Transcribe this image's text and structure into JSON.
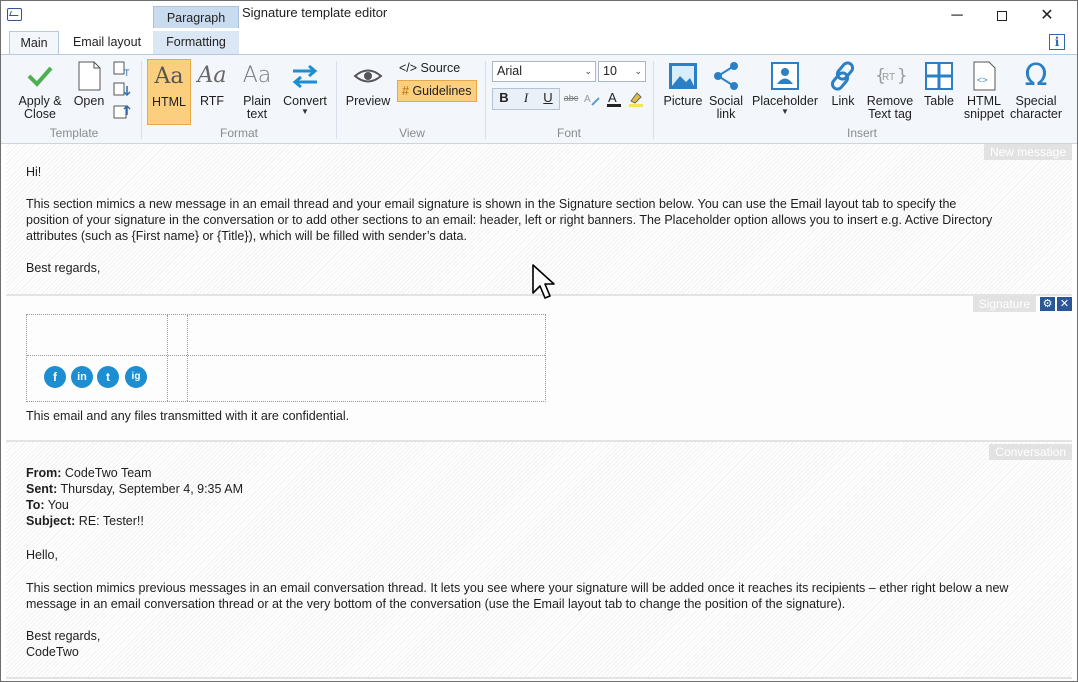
{
  "window": {
    "title": "Signature template editor",
    "context_tab": "Paragraph",
    "minimize": "─",
    "close": "✕"
  },
  "tabs": {
    "main": "Main",
    "email_layout": "Email layout",
    "formatting": "Formatting",
    "info": "i"
  },
  "ribbon": {
    "template": {
      "label": "Template",
      "apply_close": "Apply &",
      "apply_close_2": "Close",
      "open": "Open"
    },
    "format": {
      "label": "Format",
      "html": "HTML",
      "rtf": "RTF",
      "plain": "Plain",
      "plain_2": "text",
      "convert": "Convert",
      "aa": "Aa"
    },
    "view": {
      "label": "View",
      "preview": "Preview",
      "source": "</> Source",
      "guidelines": "Guidelines"
    },
    "font": {
      "label": "Font",
      "family": "Arial",
      "size": "10",
      "bold": "B",
      "italic": "I",
      "underline": "U",
      "strike": "abc"
    },
    "insert": {
      "label": "Insert",
      "picture": "Picture",
      "social": "Social",
      "social_2": "link",
      "placeholder": "Placeholder",
      "link": "Link",
      "remove": "Remove",
      "remove_2": "Text tag",
      "table": "Table",
      "html": "HTML",
      "html_2": "snippet",
      "special": "Special",
      "special_2": "character"
    }
  },
  "sections": {
    "new_message": {
      "tag": "New message",
      "greeting": "Hi!",
      "body_1": "This section mimics a new message in an email thread and your email signature is shown in the Signature section below. You can use the Email layout tab to specify the",
      "body_2": "position of your signature in the conversation or to add other sections to an email: header, left or right banners. The Placeholder option allows you to insert e.g. Active Directory",
      "body_3": "attributes (such as {First name} or {Title}), which will be filled with sender’s data.",
      "closing": "Best regards,"
    },
    "signature": {
      "tag": "Signature",
      "disclaimer": "This email and any files transmitted with it are confidential.",
      "social": [
        "f",
        "in",
        "t",
        "ig"
      ]
    },
    "conversation": {
      "tag": "Conversation",
      "from_label": "From:",
      "from": " CodeTwo Team",
      "sent_label": "Sent:",
      "sent": " Thursday, September 4, 9:35 AM",
      "to_label": "To:",
      "to": " You",
      "subject_label": "Subject:",
      "subject": " RE: Tester!!",
      "hello": "Hello,",
      "body_1": "This section mimics previous messages in an email conversation thread. It lets you see where your signature will be added once it reaches its recipients – ether right below a new",
      "body_2": "message in an email conversation thread or at the very bottom of the conversation (use the Email layout tab to change the position of the signature).",
      "closing": "Best regards,",
      "sender": "CodeTwo"
    }
  },
  "colors": {
    "accent": "#2b5797",
    "active_button": "#fbcf7e",
    "icon_blue": "#1c8ed1",
    "apply_green": "#4caf50"
  }
}
